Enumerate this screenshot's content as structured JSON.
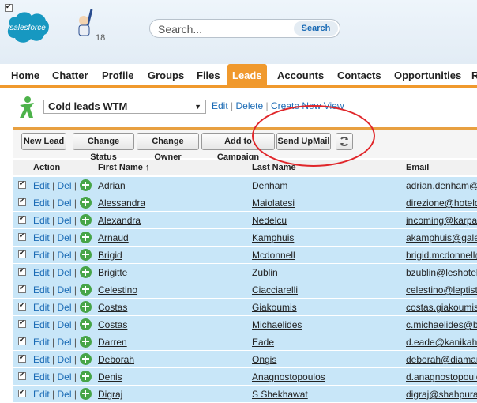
{
  "header": {
    "logo_text": "salesforce",
    "badge_count": "18",
    "search_placeholder": "Search...",
    "search_button": "Search",
    "brand_color": "#1798c1"
  },
  "tabs": [
    "Home",
    "Chatter",
    "Profile",
    "Groups",
    "Files",
    "Leads",
    "Accounts",
    "Contacts",
    "Opportunities",
    "R"
  ],
  "active_tab": "Leads",
  "view": {
    "selected": "Cold leads WTM",
    "edit": "Edit",
    "delete": "Delete",
    "create": "Create New View",
    "separator": "|"
  },
  "buttons": [
    "New Lead",
    "Change Status",
    "Change Owner",
    "Add to Campaign",
    "Send UpMail"
  ],
  "columns": {
    "action": "Action",
    "first_name": "First Name ↑",
    "last_name": "Last Name",
    "email": "Email"
  },
  "row_actions": {
    "edit": "Edit",
    "del": "Del",
    "sep": "|"
  },
  "rows": [
    {
      "first": "Adrian",
      "last": "Denham",
      "email": "adrian.denham@"
    },
    {
      "first": "Alessandra",
      "last": "Maiolatesi",
      "email": "direzione@hoteld"
    },
    {
      "first": "Alexandra",
      "last": "Nedelcu",
      "email": "incoming@karpat"
    },
    {
      "first": "Arnaud",
      "last": "Kamphuis",
      "email": "akamphuis@gale"
    },
    {
      "first": "Brigid",
      "last": "Mcdonnell",
      "email": "brigid.mcdonnell@"
    },
    {
      "first": "Brigitte",
      "last": "Zublin",
      "email": "bzublin@leshotels"
    },
    {
      "first": "Celestino",
      "last": "Ciacciarelli",
      "email": "celestino@leptisto"
    },
    {
      "first": "Costas",
      "last": "Giakoumis",
      "email": "costas.giakoumis"
    },
    {
      "first": "Costas",
      "last": "Michaelides",
      "email": "c.michaelides@bl"
    },
    {
      "first": "Darren",
      "last": "Eade",
      "email": "d.eade@kanikah"
    },
    {
      "first": "Deborah",
      "last": "Ongis",
      "email": "deborah@diamar"
    },
    {
      "first": "Denis",
      "last": "Anagnostopoulos",
      "email": "d.anagnostopoulos"
    },
    {
      "first": "Digraj",
      "last": "S Shekhawat",
      "email": "digraj@shahpura"
    }
  ]
}
